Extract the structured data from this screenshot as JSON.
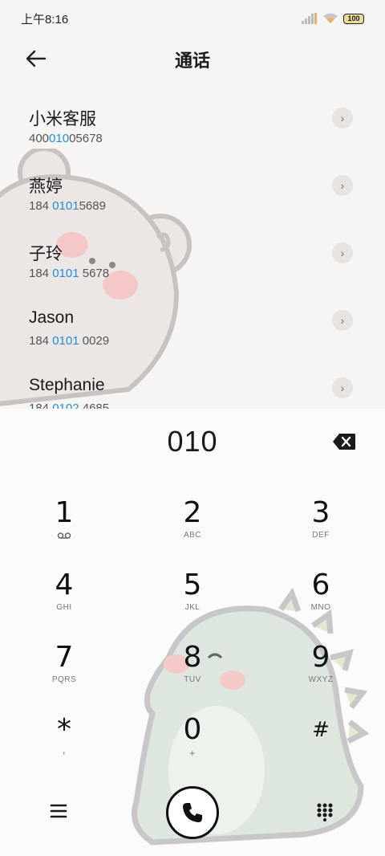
{
  "status_bar": {
    "time": "上午8:16",
    "battery": "100"
  },
  "header": {
    "title": "通话"
  },
  "contacts": [
    {
      "name": "小米客服",
      "pre": "400",
      "hl": "010",
      "post": "05678"
    },
    {
      "name": "燕婷",
      "pre": "184 ",
      "hl": "0101",
      "post": "5689"
    },
    {
      "name": "子玲",
      "pre": "184 ",
      "hl": "0101",
      "post": " 5678"
    },
    {
      "name": "Jason",
      "pre": "184 ",
      "hl": "0101",
      "post": " 0029"
    },
    {
      "name": "Stephanie",
      "pre": "184 ",
      "hl": "0102",
      "post": " 4685"
    }
  ],
  "dialer": {
    "input": "010",
    "keys": [
      {
        "digit": "1",
        "sub": ""
      },
      {
        "digit": "2",
        "sub": "ABC"
      },
      {
        "digit": "3",
        "sub": "DEF"
      },
      {
        "digit": "4",
        "sub": "GHI"
      },
      {
        "digit": "5",
        "sub": "JKL"
      },
      {
        "digit": "6",
        "sub": "MNO"
      },
      {
        "digit": "7",
        "sub": "PQRS"
      },
      {
        "digit": "8",
        "sub": "TUV"
      },
      {
        "digit": "9",
        "sub": "WXYZ"
      },
      {
        "digit": "*",
        "sub": ","
      },
      {
        "digit": "0",
        "sub": "+"
      },
      {
        "digit": "#",
        "sub": ""
      }
    ]
  },
  "icons": {
    "back": "arrow-left-icon",
    "more": "chevron-right-icon",
    "backspace": "backspace-icon",
    "voicemail": "voicemail-icon",
    "menu": "menu-icon",
    "call": "phone-icon",
    "keypad": "keypad-icon"
  },
  "colors": {
    "highlight": "#1f8fe5",
    "background": "#f7f5f3"
  }
}
